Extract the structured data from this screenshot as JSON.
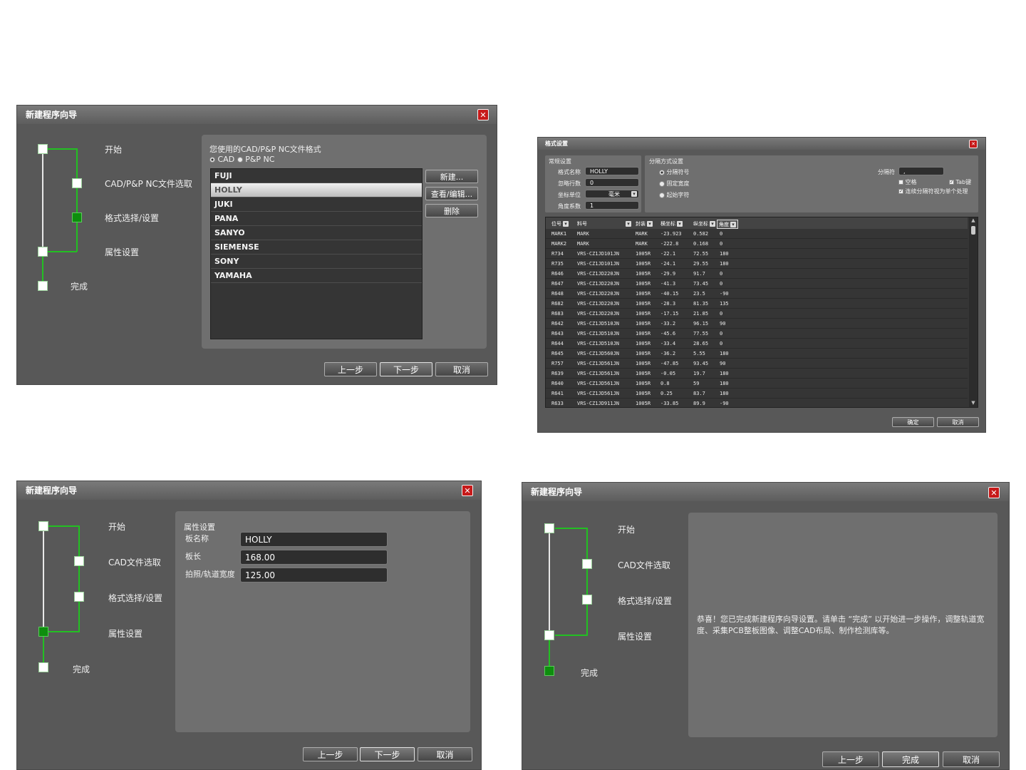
{
  "wizard1": {
    "title": "新建程序向导",
    "steps": [
      "开始",
      "CAD/P&P NC文件选取",
      "格式选择/设置",
      "属性设置",
      "完成"
    ],
    "panel_title": "您使用的CAD/P&P NC文件格式",
    "radio_cad": "CAD",
    "radio_pnp": "P&P NC",
    "formats": [
      "FUJI",
      "HOLLY",
      "JUKI",
      "PANA",
      "SANYO",
      "SIEMENSE",
      "SONY",
      "YAMAHA"
    ],
    "selected_format": "HOLLY",
    "side_buttons": {
      "new": "新建...",
      "edit": "查看/编辑...",
      "delete": "删除"
    },
    "buttons": {
      "prev": "上一步",
      "next": "下一步",
      "cancel": "取消"
    }
  },
  "format_dialog": {
    "title": "格式设置",
    "general": {
      "title": "常规设置",
      "name_label": "格式名称",
      "name_value": "HOLLY",
      "skip_label": "忽略行数",
      "skip_value": "0",
      "unit_label": "坐标单位",
      "unit_value": "毫米",
      "angle_label": "角度系数",
      "angle_value": "1"
    },
    "separator": {
      "title": "分隔方式设置",
      "opt1": "分隔符号",
      "opt2": "固定宽度",
      "opt3": "起始字符",
      "sep_label": "分隔符",
      "sep_value": ",",
      "space": "空格",
      "tab": "Tab键",
      "merge": "连续分隔符视为单个处理"
    },
    "columns": [
      "位号",
      "料号",
      "封装",
      "横坐标",
      "纵坐标",
      "角度"
    ],
    "rows": [
      [
        "MARK1",
        "MARK",
        "MARK",
        "-23.923",
        "0.582",
        "0"
      ],
      [
        "MARK2",
        "MARK",
        "MARK",
        "-222.8",
        "0.168",
        "0"
      ],
      [
        "R734",
        "VRS-CZ1JD101JN",
        "1005R",
        "-22.1",
        "72.55",
        "180"
      ],
      [
        "R735",
        "VRS-CZ1JD101JN",
        "1005R",
        "-24.1",
        "29.55",
        "180"
      ],
      [
        "R646",
        "VRS-CZ1JD220JN",
        "1005R",
        "-29.9",
        "91.7",
        "0"
      ],
      [
        "R647",
        "VRS-CZ1JD220JN",
        "1005R",
        "-41.3",
        "73.45",
        "0"
      ],
      [
        "R648",
        "VRS-CZ1JD220JN",
        "1005R",
        "-40.15",
        "23.5",
        "-90"
      ],
      [
        "R682",
        "VRS-CZ1JD220JN",
        "1005R",
        "-28.3",
        "81.35",
        "135"
      ],
      [
        "R683",
        "VRS-CZ1JD220JN",
        "1005R",
        "-17.15",
        "21.85",
        "0"
      ],
      [
        "R642",
        "VRS-CZ1JD510JN",
        "1005R",
        "-33.2",
        "96.15",
        "90"
      ],
      [
        "R643",
        "VRS-CZ1JD510JN",
        "1005R",
        "-45.6",
        "77.55",
        "0"
      ],
      [
        "R644",
        "VRS-CZ1JD510JN",
        "1005R",
        "-33.4",
        "28.65",
        "0"
      ],
      [
        "R645",
        "VRS-CZ1JD560JN",
        "1005R",
        "-36.2",
        "5.55",
        "180"
      ],
      [
        "R757",
        "VRS-CZ1JD561JN",
        "1005R",
        "-47.85",
        "93.45",
        "90"
      ],
      [
        "R639",
        "VRS-CZ1JD561JN",
        "1005R",
        "-0.05",
        "19.7",
        "180"
      ],
      [
        "R640",
        "VRS-CZ1JD561JN",
        "1005R",
        "0.8",
        "59",
        "180"
      ],
      [
        "R641",
        "VRS-CZ1JD561JN",
        "1005R",
        "0.25",
        "83.7",
        "180"
      ],
      [
        "R633",
        "VRS-CZ1JD911JN",
        "1005R",
        "-33.85",
        "89.9",
        "-90"
      ]
    ],
    "buttons": {
      "ok": "确定",
      "cancel": "取消"
    }
  },
  "wizard3": {
    "title": "新建程序向导",
    "steps": [
      "开始",
      "CAD文件选取",
      "格式选择/设置",
      "属性设置",
      "完成"
    ],
    "panel_title": "属性设置",
    "fields": [
      {
        "label": "板名称",
        "value": "HOLLY"
      },
      {
        "label": "板长",
        "value": "168.00"
      },
      {
        "label": "拍照/轨道宽度",
        "value": "125.00"
      }
    ],
    "buttons": {
      "prev": "上一步",
      "next": "下一步",
      "cancel": "取消"
    }
  },
  "wizard4": {
    "title": "新建程序向导",
    "steps": [
      "开始",
      "CAD文件选取",
      "格式选择/设置",
      "属性设置",
      "完成"
    ],
    "message": "恭喜！您已完成新建程序向导设置。请单击 “完成” 以开始进一步操作，调整轨道宽度、采集PCB整板图像、调整CAD布局、制作检测库等。",
    "buttons": {
      "prev": "上一步",
      "finish": "完成",
      "cancel": "取消"
    }
  }
}
